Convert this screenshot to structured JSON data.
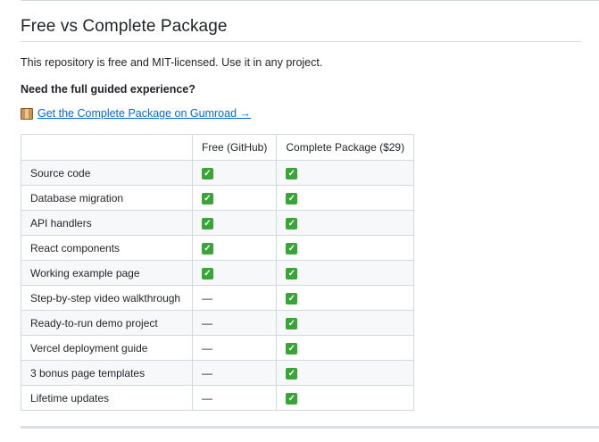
{
  "section": {
    "title": "Free vs Complete Package",
    "intro": "This repository is free and MIT-licensed. Use it in any project.",
    "subheading": "Need the full guided experience?",
    "link_text": "Get the Complete Package on Gumroad →"
  },
  "table": {
    "headers": [
      "",
      "Free (GitHub)",
      "Complete Package ($29)"
    ],
    "rows": [
      {
        "feature": "Source code",
        "free": "✓",
        "complete": "✓"
      },
      {
        "feature": "Database migration",
        "free": "✓",
        "complete": "✓"
      },
      {
        "feature": "API handlers",
        "free": "✓",
        "complete": "✓"
      },
      {
        "feature": "React components",
        "free": "✓",
        "complete": "✓"
      },
      {
        "feature": "Working example page",
        "free": "✓",
        "complete": "✓"
      },
      {
        "feature": "Step-by-step video walkthrough",
        "free": "—",
        "complete": "✓"
      },
      {
        "feature": "Ready-to-run demo project",
        "free": "—",
        "complete": "✓"
      },
      {
        "feature": "Vercel deployment guide",
        "free": "—",
        "complete": "✓"
      },
      {
        "feature": "3 bonus page templates",
        "free": "—",
        "complete": "✓"
      },
      {
        "feature": "Lifetime updates",
        "free": "—",
        "complete": "✓"
      }
    ]
  },
  "icons": {
    "package": "package-icon",
    "check": "check-mark-icon"
  },
  "colors": {
    "link": "#0969da",
    "check": "#3aa43a"
  }
}
